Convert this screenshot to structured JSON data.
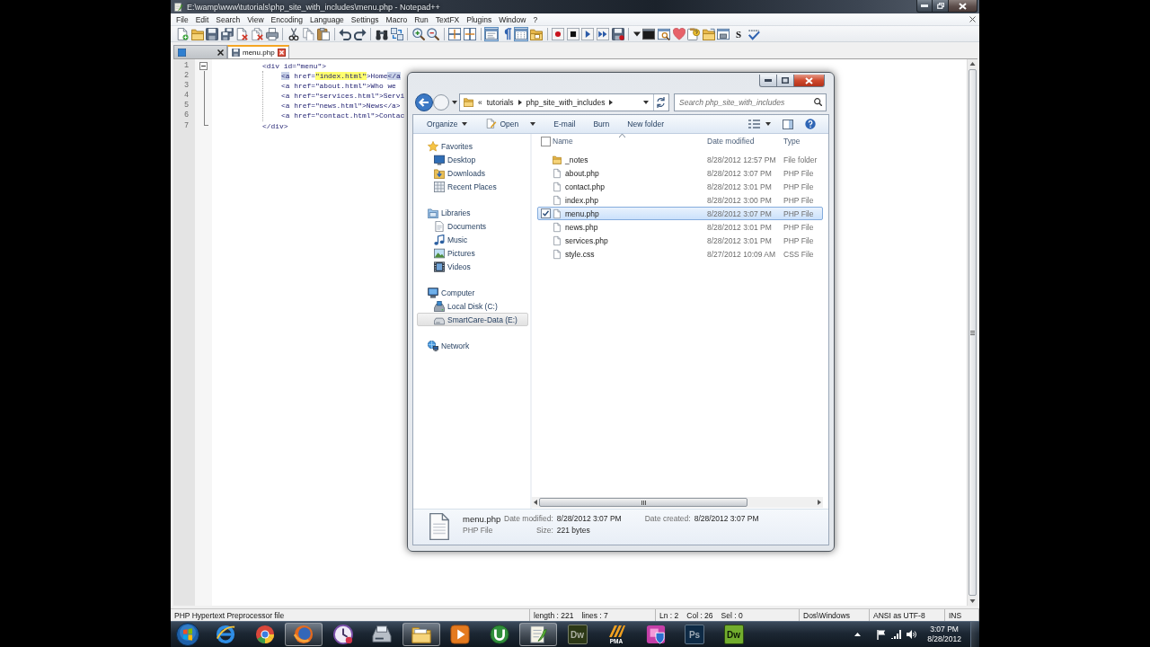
{
  "window": {
    "title": "E:\\wamp\\www\\tutorials\\php_site_with_includes\\menu.php - Notepad++"
  },
  "menu": [
    "File",
    "Edit",
    "Search",
    "View",
    "Encoding",
    "Language",
    "Settings",
    "Macro",
    "Run",
    "TextFX",
    "Plugins",
    "Window",
    "?"
  ],
  "toolbar": {
    "toggles": [
      {
        "pressed": true
      },
      {
        "pressed": false
      },
      {
        "pressed": true
      },
      {
        "pressed": false
      }
    ],
    "letter_button": "S"
  },
  "tabs": [
    {
      "selected": false
    },
    {
      "label": "menu.php",
      "selected": true
    }
  ],
  "code": {
    "lines": [
      {
        "number": "1",
        "text": "<div id=\"menu\">",
        "expanded": true,
        "children": [
          {
            "number": "2",
            "parts": [
              {
                "text": "<a",
                "kind": "tag"
              },
              {
                "text": " href=",
                "kind": "plain"
              },
              {
                "text": "\"index.html\"",
                "kind": "smart"
              },
              {
                "text": ">Home",
                "kind": "plain"
              },
              {
                "text": "</a",
                "kind": "tag"
              }
            ]
          },
          {
            "number": "3",
            "text": "<a href=\"about.html\">Who we"
          },
          {
            "number": "4",
            "text": "<a href=\"services.html\">Servi"
          },
          {
            "number": "5",
            "text": "<a href=\"news.html\">News</a>"
          },
          {
            "number": "6",
            "text": "<a href=\"contact.html\">Contac"
          }
        ]
      },
      {
        "number": "7",
        "text": "</div>"
      }
    ]
  },
  "status_bar": [
    {
      "texts": [
        "PHP Hypertext Preprocessor file"
      ]
    },
    {
      "texts": [
        "length : 221",
        "lines : 7"
      ]
    },
    {
      "texts": [
        "Ln : 2",
        "Col : 26",
        "Sel : 0"
      ]
    },
    {
      "texts": [
        "Dos\\Windows"
      ]
    },
    {
      "texts": [
        "ANSI as UTF-8"
      ]
    },
    {
      "texts": [
        "INS"
      ]
    }
  ],
  "taskbar": {
    "apps": [
      {
        "kind": "e-logo",
        "selected": false
      },
      {
        "kind": "ring-logo",
        "selected": false
      },
      {
        "kind": "fox-logo",
        "selected": true
      },
      {
        "kind": "clock",
        "selected": false
      },
      {
        "kind": "scanner",
        "selected": false
      },
      {
        "kind": "folder",
        "selected": true
      },
      {
        "kind": "play-tile",
        "selected": false
      },
      {
        "kind": "torrent-logo",
        "selected": false
      },
      {
        "kind": "notepad",
        "selected": true
      },
      {
        "kind": "dark-tile",
        "label": "Dw",
        "color": "#2c3816",
        "selected": false
      },
      {
        "kind": "stripe-logo",
        "label": "PMA",
        "selected": false
      },
      {
        "kind": "shield-app",
        "selected": false
      },
      {
        "kind": "dark-tile",
        "label": "Ps",
        "color": "#0e2a45",
        "selected": false
      },
      {
        "kind": "bright-tile",
        "label": "Dw",
        "color": "#72ad2e",
        "selected": false
      }
    ],
    "clock": {
      "time": "3:07 PM",
      "date": "8/28/2012"
    }
  },
  "explorer": {
    "address": {
      "overflow": "«",
      "crumbs": [
        "tutorials",
        "php_site_with_includes"
      ]
    },
    "search": {
      "placeholder": "Search php_site_with_includes"
    },
    "commands": [
      {
        "label": "Organize",
        "kind": "menu"
      },
      {
        "label": "Open",
        "kind": "open-menu"
      },
      {
        "label": "E-mail",
        "kind": "plain"
      },
      {
        "label": "Burn",
        "kind": "plain"
      },
      {
        "label": "New folder",
        "kind": "plain"
      }
    ],
    "nav": [
      {
        "label": "Favorites",
        "kind": "star",
        "selected": false,
        "children": [
          {
            "label": "Desktop",
            "kind": "desktop",
            "selected": false
          },
          {
            "label": "Downloads",
            "kind": "downloads",
            "selected": false
          },
          {
            "label": "Recent Places",
            "kind": "recent",
            "selected": false
          }
        ]
      },
      {
        "label": "Libraries",
        "kind": "libraries",
        "selected": false,
        "children": [
          {
            "label": "Documents",
            "kind": "documents",
            "selected": false
          },
          {
            "label": "Music",
            "kind": "music",
            "selected": false
          },
          {
            "label": "Pictures",
            "kind": "pictures",
            "selected": false
          },
          {
            "label": "Videos",
            "kind": "videos",
            "selected": false
          }
        ]
      },
      {
        "label": "Computer",
        "kind": "computer",
        "selected": false,
        "children": [
          {
            "label": "Local Disk (C:)",
            "kind": "disk",
            "selected": false
          },
          {
            "label": "SmartCare-Data (E:)",
            "kind": "drive",
            "selected": true
          }
        ]
      },
      {
        "label": "Network",
        "kind": "network",
        "selected": false
      }
    ],
    "select_all": {
      "checked": false
    },
    "columns": [
      {
        "label": "Name",
        "sorted": true
      },
      {
        "label": "Date modified",
        "sorted": false
      },
      {
        "label": "Type",
        "sorted": false
      }
    ],
    "files": [
      {
        "name": "_notes",
        "date": "8/28/2012 12:57 PM",
        "type": "File folder",
        "kind": "folder",
        "selected": false
      },
      {
        "name": "about.php",
        "date": "8/28/2012 3:07 PM",
        "type": "PHP File",
        "kind": "file",
        "selected": false
      },
      {
        "name": "contact.php",
        "date": "8/28/2012 3:01 PM",
        "type": "PHP File",
        "kind": "file",
        "selected": false
      },
      {
        "name": "index.php",
        "date": "8/28/2012 3:00 PM",
        "type": "PHP File",
        "kind": "file",
        "selected": false
      },
      {
        "name": "menu.php",
        "date": "8/28/2012 3:07 PM",
        "type": "PHP File",
        "kind": "file",
        "selected": true
      },
      {
        "name": "news.php",
        "date": "8/28/2012 3:01 PM",
        "type": "PHP File",
        "kind": "file",
        "selected": false
      },
      {
        "name": "services.php",
        "date": "8/28/2012 3:01 PM",
        "type": "PHP File",
        "kind": "file",
        "selected": false
      },
      {
        "name": "style.css",
        "date": "8/27/2012 10:09 AM",
        "type": "CSS File",
        "kind": "file",
        "selected": false
      }
    ],
    "details": {
      "name": "menu.php",
      "type": "PHP File",
      "fields": [
        {
          "label": "Date modified:",
          "value": "8/28/2012 3:07 PM"
        },
        {
          "label": "Size:",
          "value": "221 bytes"
        },
        {
          "label": "Date created:",
          "value": "8/28/2012 3:07 PM"
        }
      ]
    }
  }
}
